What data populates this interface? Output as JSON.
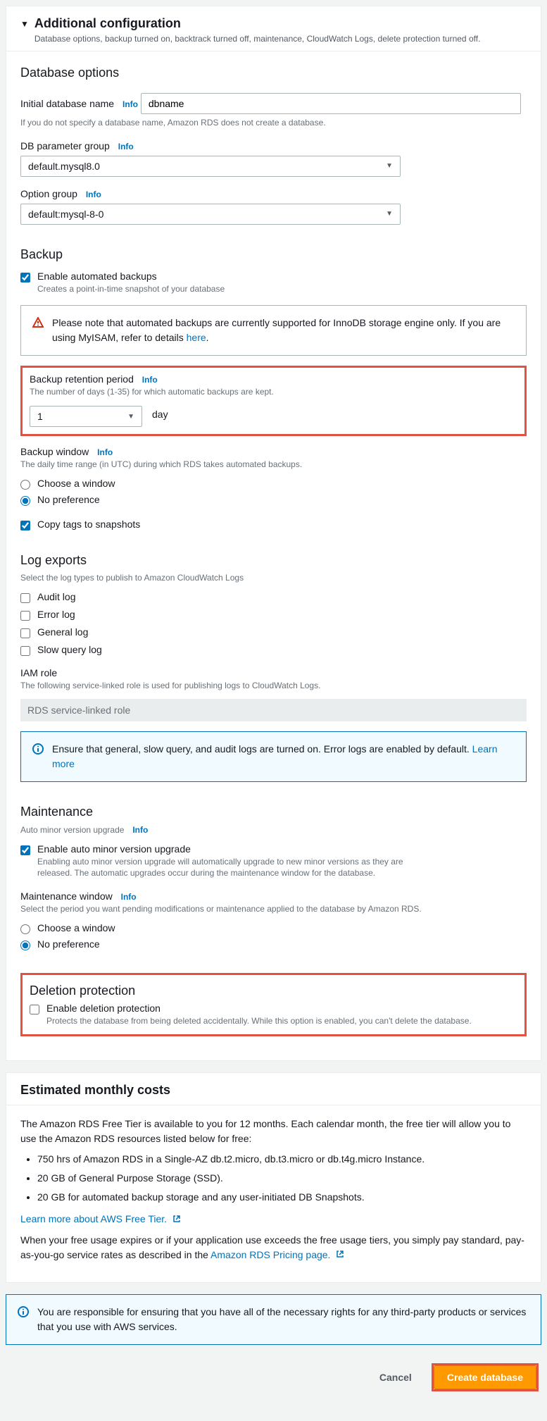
{
  "header": {
    "title": "Additional configuration",
    "subtitle": "Database options, backup turned on, backtrack turned off, maintenance, CloudWatch Logs, delete protection turned off."
  },
  "dbOptions": {
    "title": "Database options",
    "initialDbName": {
      "label": "Initial database name",
      "info": "Info",
      "value": "dbname",
      "hint": "If you do not specify a database name, Amazon RDS does not create a database."
    },
    "paramGroup": {
      "label": "DB parameter group",
      "info": "Info",
      "value": "default.mysql8.0"
    },
    "optionGroup": {
      "label": "Option group",
      "info": "Info",
      "value": "default:mysql-8-0"
    }
  },
  "backup": {
    "title": "Backup",
    "enable": {
      "label": "Enable automated backups",
      "hint": "Creates a point-in-time snapshot of your database",
      "checked": true
    },
    "warning": {
      "text": "Please note that automated backups are currently supported for InnoDB storage engine only. If you are using MyISAM, refer to details ",
      "link": "here"
    },
    "retention": {
      "label": "Backup retention period",
      "info": "Info",
      "hint": "The number of days (1-35) for which automatic backups are kept.",
      "value": "1",
      "unit": "day"
    },
    "window": {
      "label": "Backup window",
      "info": "Info",
      "hint": "The daily time range (in UTC) during which RDS takes automated backups.",
      "optChoose": "Choose a window",
      "optNoPref": "No preference"
    },
    "copyTags": {
      "label": "Copy tags to snapshots",
      "checked": true
    }
  },
  "logExports": {
    "title": "Log exports",
    "hint": "Select the log types to publish to Amazon CloudWatch Logs",
    "audit": "Audit log",
    "error": "Error log",
    "general": "General log",
    "slow": "Slow query log",
    "iamLabel": "IAM role",
    "iamHint": "The following service-linked role is used for publishing logs to CloudWatch Logs.",
    "iamValue": "RDS service-linked role",
    "infoBox": {
      "text": "Ensure that general, slow query, and audit logs are turned on. Error logs are enabled by default. ",
      "link": "Learn more"
    }
  },
  "maintenance": {
    "title": "Maintenance",
    "sub": "Auto minor version upgrade",
    "subInfo": "Info",
    "enable": {
      "label": "Enable auto minor version upgrade",
      "hint": "Enabling auto minor version upgrade will automatically upgrade to new minor versions as they are released. The automatic upgrades occur during the maintenance window for the database.",
      "checked": true
    },
    "window": {
      "label": "Maintenance window",
      "info": "Info",
      "hint": "Select the period you want pending modifications or maintenance applied to the database by Amazon RDS.",
      "optChoose": "Choose a window",
      "optNoPref": "No preference"
    }
  },
  "deletion": {
    "title": "Deletion protection",
    "enable": {
      "label": "Enable deletion protection",
      "hint": "Protects the database from being deleted accidentally. While this option is enabled, you can't delete the database.",
      "checked": false
    }
  },
  "costs": {
    "title": "Estimated monthly costs",
    "intro": "The Amazon RDS Free Tier is available to you for 12 months. Each calendar month, the free tier will allow you to use the Amazon RDS resources listed below for free:",
    "b1": "750 hrs of Amazon RDS in a Single-AZ db.t2.micro, db.t3.micro or db.t4g.micro Instance.",
    "b2": "20 GB of General Purpose Storage (SSD).",
    "b3": "20 GB for automated backup storage and any user-initiated DB Snapshots.",
    "learnLink": "Learn more about AWS Free Tier.",
    "outro1": "When your free usage expires or if your application use exceeds the free usage tiers, you simply pay standard, pay-as-you-go service rates as described in the ",
    "pricingLink": "Amazon RDS Pricing page."
  },
  "responsibility": {
    "text": "You are responsible for ensuring that you have all of the necessary rights for any third-party products or services that you use with AWS services."
  },
  "actions": {
    "cancel": "Cancel",
    "create": "Create database"
  }
}
